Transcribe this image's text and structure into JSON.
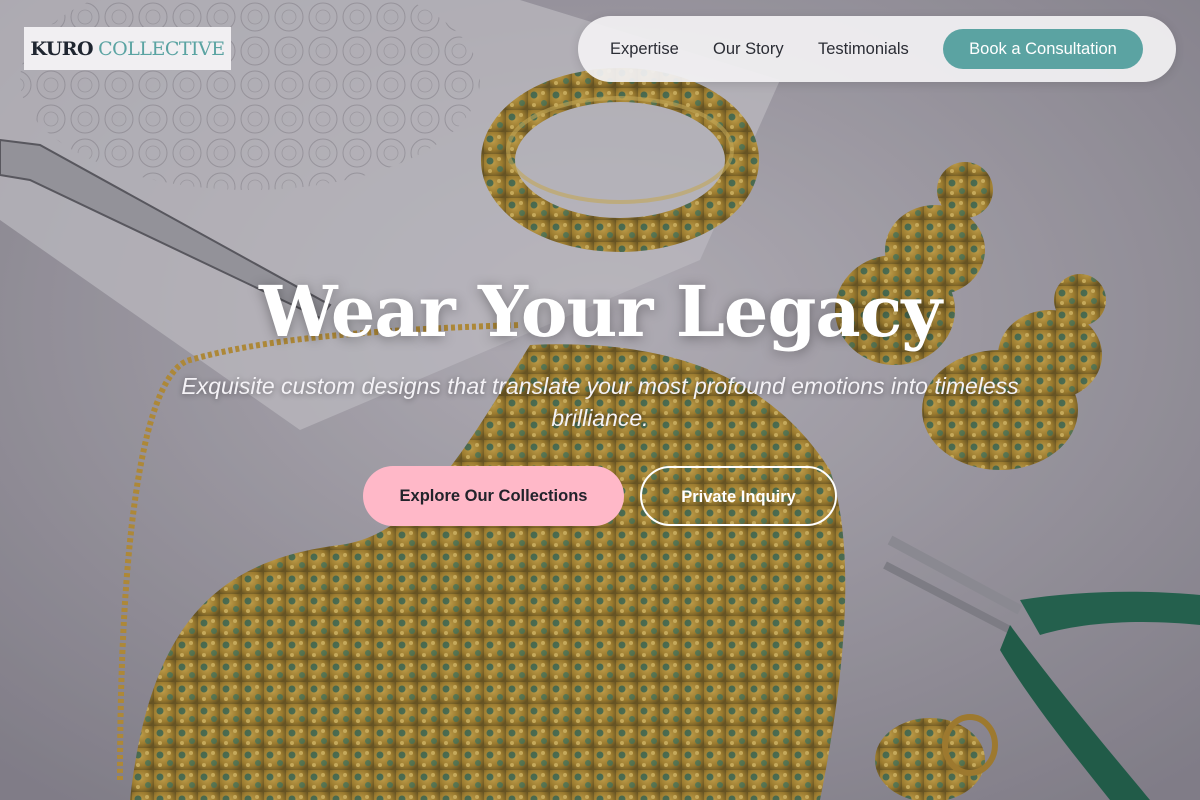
{
  "brand": {
    "name_part1": "KURO",
    "name_part2": "COLLECTIVE"
  },
  "nav": {
    "links": [
      "Expertise",
      "Our Story",
      "Testimonials"
    ],
    "cta": "Book a Consultation"
  },
  "hero": {
    "title": "Wear Your Legacy",
    "subtitle": "Exquisite custom designs that translate your most profound emotions into timeless brilliance.",
    "primary_button": "Explore Our Collections",
    "secondary_button": "Private Inquiry",
    "background": "jewelry-workbench-photo"
  },
  "colors": {
    "accent": "#5ba3a2",
    "primary_button": "#ffb8c8",
    "logo_dark": "#1f2530"
  }
}
